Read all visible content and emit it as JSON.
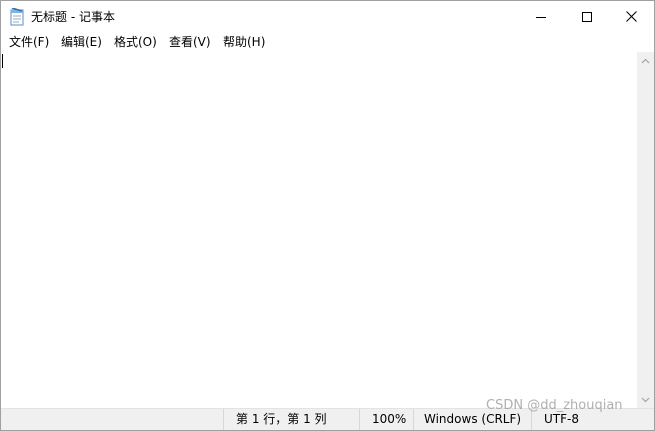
{
  "window": {
    "title": "无标题 - 记事本"
  },
  "icons": {
    "app": "notepad-icon",
    "minimize": "minimize-icon",
    "maximize": "maximize-icon",
    "close": "close-icon",
    "scroll_up": "chevron-up-icon",
    "scroll_down": "chevron-down-icon"
  },
  "menu": [
    "文件(F)",
    "编辑(E)",
    "格式(O)",
    "查看(V)",
    "帮助(H)"
  ],
  "editor": {
    "content": ""
  },
  "status": {
    "position": "第 1 行，第 1 列",
    "zoom": "100%",
    "line_ending": "Windows (CRLF)",
    "encoding": "UTF-8"
  },
  "watermark": "CSDN @dd_zhouqian",
  "colors": {
    "chrome": "#f0f0f0",
    "border": "#a0a0a0",
    "background": "#ffffff"
  }
}
